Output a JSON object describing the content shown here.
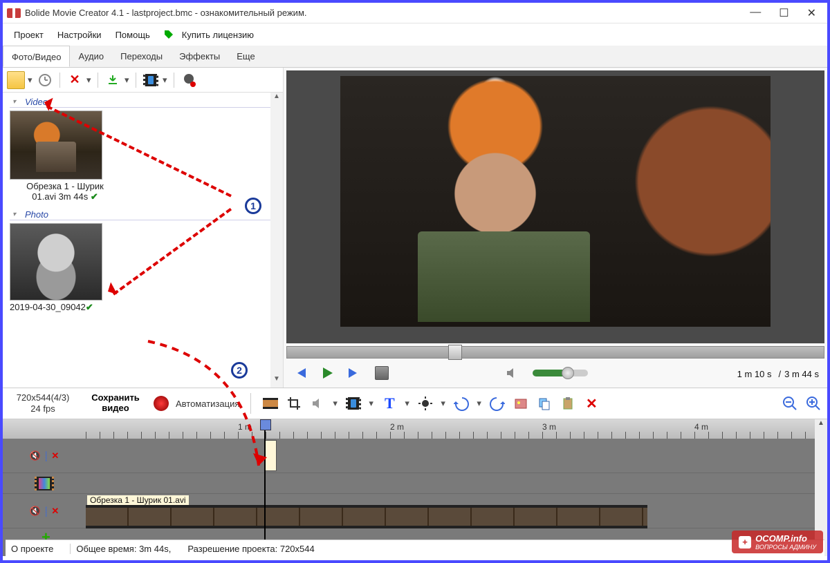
{
  "title": "Bolide Movie Creator 4.1 - lastproject.bmc  - ознакомительный режим.",
  "menu": {
    "project": "Проект",
    "settings": "Настройки",
    "help": "Помощь",
    "buy": "Купить лицензию"
  },
  "tabs": {
    "photovideo": "Фото/Видео",
    "audio": "Аудио",
    "transitions": "Переходы",
    "effects": "Эффекты",
    "more": "Еще"
  },
  "library": {
    "video_header": "Video",
    "video_caption_l1": "Обрезка 1 - Шурик",
    "video_caption_l2": "01.avi 3m 44s",
    "photo_header": "Photo",
    "photo_caption": "2019-04-30_09042"
  },
  "preview": {
    "time_current": "1 m 10 s",
    "time_sep": "/",
    "time_total": "3 m 44 s"
  },
  "tl_toolbar": {
    "info_l1": "720x544(4/3)",
    "info_l2": "24 fps",
    "save_l1": "Сохранить",
    "save_l2": "видео",
    "auto": "Автоматизация"
  },
  "ruler": {
    "m1": "1 m",
    "m2": "2 m",
    "m3": "3 m",
    "m4": "4 m"
  },
  "timeline": {
    "clip_label": "Обрезка 1 - Шурик 01.avi"
  },
  "status": {
    "about": "О проекте",
    "total": "Общее время: 3m 44s,",
    "res": "Разрешение проекта:  720x544"
  },
  "annot": {
    "b1": "1",
    "b2": "2"
  },
  "watermark": {
    "main": "OCOMP.info",
    "sub": "ВОПРОСЫ АДМИНУ"
  }
}
